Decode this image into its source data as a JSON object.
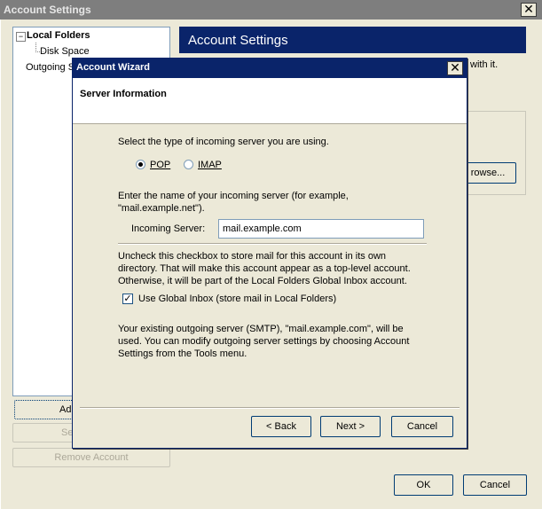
{
  "window": {
    "title": "Account Settings",
    "close_glyph": "✕"
  },
  "tree": {
    "expander": "−",
    "root": "Local Folders",
    "child": "Disk Space",
    "outgoing_partial": "Outgoing S"
  },
  "left_buttons": {
    "add_partial": "Add",
    "second_partial": "Se",
    "remove_account": "Remove Account"
  },
  "right": {
    "header": "Account Settings",
    "partial_text": "with it.",
    "browse_partial": "rowse..."
  },
  "wizard": {
    "title": "Account Wizard",
    "close_glyph": "✕",
    "header_title": "Server Information",
    "select_type": "Select the type of incoming server you are using.",
    "radio_pop": "POP",
    "radio_imap": "IMAP",
    "enter_name_line1": "Enter the name of your incoming server (for example,",
    "enter_name_line2": "\"mail.example.net\").",
    "incoming_label": "Incoming Server:",
    "incoming_value": "mail.example.com",
    "uncheck_line1": "Uncheck this checkbox to store mail for this account in its own",
    "uncheck_line2": "directory. That will make this account appear as a top-level account.",
    "uncheck_line3": "Otherwise, it will be part of the Local Folders Global Inbox account.",
    "global_inbox_label": "Use Global Inbox (store mail in Local Folders)",
    "check_glyph": "✓",
    "smtp_line1": "Your existing outgoing server (SMTP), \"mail.example.com\", will be",
    "smtp_line2": "used. You can modify outgoing server settings by choosing Account",
    "smtp_line3": "Settings from the Tools menu.",
    "back": "< Back",
    "next": "Next >",
    "cancel": "Cancel"
  },
  "footer": {
    "ok": "OK",
    "cancel": "Cancel"
  }
}
